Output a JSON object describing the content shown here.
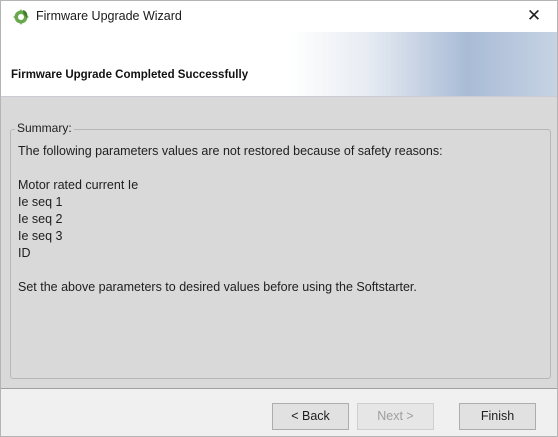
{
  "window": {
    "title": "Firmware Upgrade Wizard",
    "close_glyph": "✕",
    "icon": "gear-leaf-app-icon"
  },
  "header": {
    "title": "Firmware Upgrade Completed Successfully"
  },
  "summary": {
    "legend": "Summary:",
    "intro": "The following parameters values are not restored because of safety reasons:",
    "parameters": [
      "Motor rated current Ie",
      "Ie seq 1",
      "Ie seq 2",
      "Ie seq 3",
      "ID"
    ],
    "footer": "Set the above parameters to desired values before using the Softstarter."
  },
  "buttons": {
    "back": "< Back",
    "next": "Next >",
    "finish": "Finish"
  },
  "colors": {
    "header_accent": "#a9bbd6",
    "content_bg": "#d9d9d9",
    "disabled_text": "#9e9e9e"
  }
}
